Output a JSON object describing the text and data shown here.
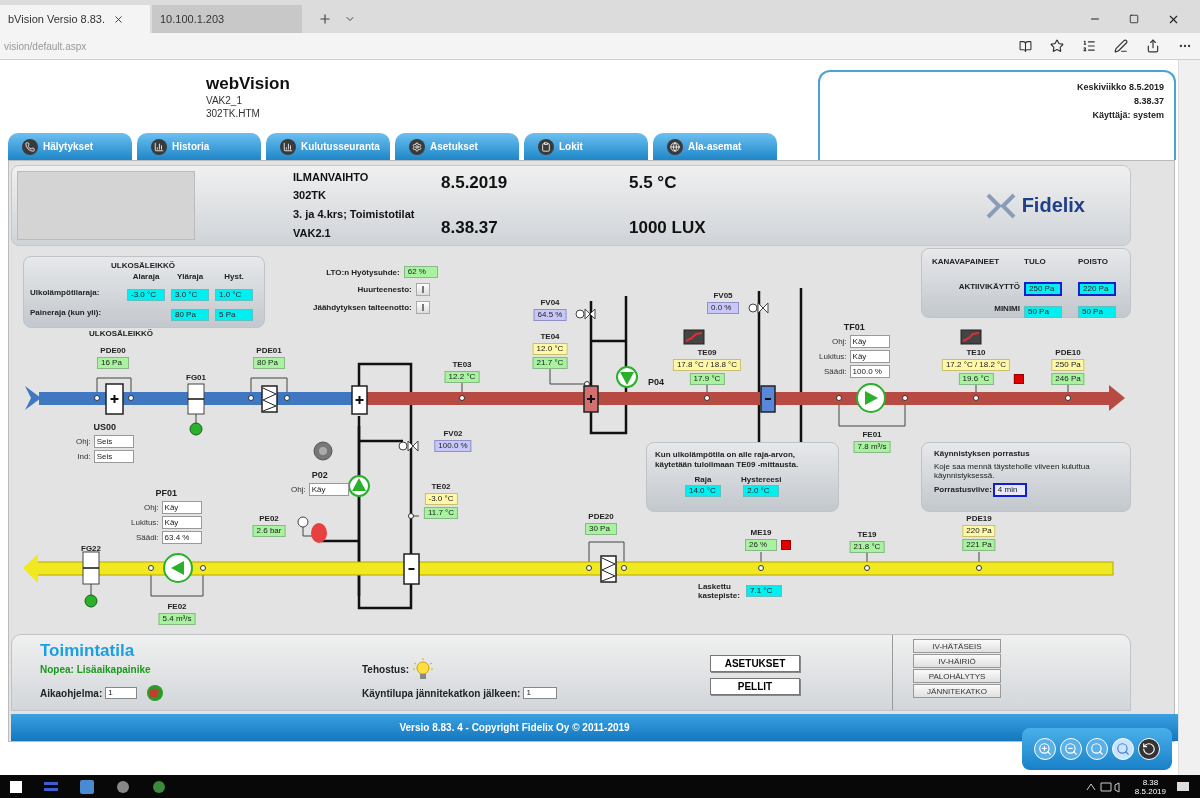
{
  "browser": {
    "tabs": [
      {
        "label": "bVision Versio 8.83.",
        "selected": true
      },
      {
        "label": "10.100.1.203",
        "selected": false
      }
    ],
    "address": "vision/default.aspx"
  },
  "header": {
    "title": "webVision",
    "lines": [
      "VAK2_1",
      "302TK.HTM"
    ],
    "day": "Keskiviikko 8.5.2019",
    "time": "8.38.37",
    "user": "Käyttäjä: system"
  },
  "nav": [
    "Hälytykset",
    "Historia",
    "Kulutusseuranta",
    "Asetukset",
    "Lokit",
    "Ala-asemat"
  ],
  "info": {
    "lines": [
      "ILMANVAIHTO",
      "302TK",
      "3. ja 4.krs; Toimistotilat",
      "VAK2.1"
    ],
    "date": "8.5.2019",
    "time": "8.38.37",
    "temperature": "5.5 °C",
    "lux": "1000 LUX",
    "logo": "Fidelix"
  },
  "outdoor_panel": {
    "title": "ULKOSÄLEIKKÖ",
    "columns": [
      "Alaraja",
      "Yläraja",
      "Hyst."
    ],
    "rows": [
      {
        "label": "Ulkolämpötilaraja:",
        "values": [
          {
            "text": "-3.0 °C",
            "kind": "param"
          },
          {
            "text": "3.0 °C",
            "kind": "param"
          },
          {
            "text": "1.0 °C",
            "kind": "param"
          }
        ]
      },
      {
        "label": "Paineraja (kun yli):",
        "values": [
          {
            "text": "80 Pa",
            "kind": "param"
          },
          {
            "text": "5 Pa",
            "kind": "param"
          }
        ]
      }
    ]
  },
  "lto": {
    "label": "LTO:n Hyötysuhde:",
    "value": "62 %",
    "toggles": [
      "Huurteenesto:",
      "Jäähdytyksen talteenotto:"
    ]
  },
  "duct_pressures": {
    "title": "KANAVAPAINEET",
    "columns": [
      "TULO",
      "POISTO"
    ],
    "rows": [
      {
        "label": "AKTIIVIKÄYTTÖ",
        "values": [
          {
            "text": "250 Pa",
            "kind": "active"
          },
          {
            "text": "220 Pa",
            "kind": "active"
          }
        ]
      },
      {
        "label": "MINIMI",
        "values": [
          {
            "text": "50 Pa",
            "kind": "param"
          },
          {
            "text": "50 Pa",
            "kind": "param"
          }
        ]
      }
    ]
  },
  "labels": [
    "ULKOSÄLEIKKÖ",
    "FG01",
    "P04",
    "FG22"
  ],
  "points": [
    {
      "tag": "PDE00",
      "alarm": false,
      "values": [
        {
          "text": "16 Pa",
          "kind": "measured"
        }
      ]
    },
    {
      "tag": "PDE01",
      "alarm": false,
      "values": [
        {
          "text": "80 Pa",
          "kind": "measured"
        }
      ]
    },
    {
      "tag": "TE03",
      "alarm": false,
      "values": [
        {
          "text": "12.2 °C",
          "kind": "measured"
        }
      ]
    },
    {
      "tag": "FV04",
      "alarm": false,
      "values": [
        {
          "text": "64.5 %",
          "kind": "valve"
        }
      ]
    },
    {
      "tag": "TE04",
      "alarm": false,
      "values": [
        {
          "text": "12.0 °C",
          "kind": "setpoint"
        },
        {
          "text": "21.7 °C",
          "kind": "measured"
        }
      ]
    },
    {
      "tag": "FV05",
      "alarm": false,
      "values": [
        {
          "text": "0.0 %",
          "kind": "valve"
        }
      ]
    },
    {
      "tag": "TE09",
      "alarm": false,
      "values": [
        {
          "text": "17.8 °C / 18.8 °C",
          "kind": "setpoint"
        },
        {
          "text": "17.9 °C",
          "kind": "measured"
        }
      ]
    },
    {
      "tag": "TE10",
      "alarm": true,
      "values": [
        {
          "text": "17.2 °C / 18.2 °C",
          "kind": "setpoint"
        },
        {
          "text": "19.6 °C",
          "kind": "measured"
        }
      ]
    },
    {
      "tag": "PDE10",
      "alarm": false,
      "values": [
        {
          "text": "250 Pa",
          "kind": "setpoint"
        },
        {
          "text": "246 Pa",
          "kind": "measured"
        }
      ]
    },
    {
      "tag": "FV02",
      "alarm": false,
      "values": [
        {
          "text": "100.0 %",
          "kind": "valve"
        }
      ]
    },
    {
      "tag": "FE01",
      "alarm": false,
      "values": [
        {
          "text": "7.8 m³/s",
          "kind": "measured"
        }
      ]
    },
    {
      "tag": "TE02",
      "alarm": false,
      "values": [
        {
          "text": "-3.0 °C",
          "kind": "setpoint"
        },
        {
          "text": "11.7 °C",
          "kind": "measured"
        }
      ]
    },
    {
      "tag": "PE02",
      "alarm": false,
      "values": [
        {
          "text": "2.6 bar",
          "kind": "measured"
        }
      ]
    },
    {
      "tag": "PDE20",
      "alarm": false,
      "values": [
        {
          "text": "30 Pa",
          "kind": "measured"
        }
      ]
    },
    {
      "tag": "ME19",
      "alarm": true,
      "values": [
        {
          "text": "26 %",
          "kind": "measured"
        }
      ]
    },
    {
      "tag": "TE19",
      "alarm": false,
      "values": [
        {
          "text": "21.8 °C",
          "kind": "measured"
        }
      ]
    },
    {
      "tag": "PDE19",
      "alarm": false,
      "values": [
        {
          "text": "220 Pa",
          "kind": "setpoint"
        },
        {
          "text": "221 Pa",
          "kind": "measured"
        }
      ]
    },
    {
      "tag": "FE02",
      "alarm": false,
      "values": [
        {
          "text": "5.4 m³/s",
          "kind": "measured"
        }
      ]
    }
  ],
  "units": [
    {
      "tag": "US00",
      "rows": [
        {
          "label": "Ohj:",
          "value": "Seis"
        },
        {
          "label": "Ind:",
          "value": "Seis"
        }
      ]
    },
    {
      "tag": "TF01",
      "rows": [
        {
          "label": "Ohj:",
          "value": "Käy"
        },
        {
          "label": "Lukitus:",
          "value": "Käy"
        },
        {
          "label": "Säädi:",
          "value": "100.0 %"
        }
      ]
    },
    {
      "tag": "P02",
      "rows": [
        {
          "label": "Ohj:",
          "value": "Käy"
        }
      ]
    },
    {
      "tag": "PF01",
      "rows": [
        {
          "label": "Ohj:",
          "value": "Käy"
        },
        {
          "label": "Lukitus:",
          "value": "Käy"
        },
        {
          "label": "Säädi:",
          "value": "63.4 %"
        }
      ]
    }
  ],
  "dewpoint": {
    "label": "Laskettu kastepiste:",
    "value": "7.1 °C"
  },
  "condition_panel": {
    "text": "Kun ulkolämpötila on alle raja-arvon, käytetään tuloilmaan TE09 -mittausta.",
    "fields": [
      {
        "label": "Raja",
        "value": "14.0 °C"
      },
      {
        "label": "Hystereesi",
        "value": "2.0 °C"
      }
    ]
  },
  "startup_panel": {
    "title": "Käynnistyksen porrastus",
    "text": "Koje saa mennä täysteholle viiveen kuluttua käynnistyksessä.",
    "field_label": "Porrastusviive:",
    "field_value": "4 min"
  },
  "bottom": {
    "title": "Toimintatila",
    "mode": "Nopea: Lisäaikapainike",
    "schedule_label": "Aikaohjelma:",
    "schedule_value": "1",
    "boost_label": "Tehostus:",
    "restart_label": "Käyntilupa jännitekatkon jälkeen:",
    "restart_value": "1",
    "buttons": [
      "ASETUKSET",
      "PELLIT"
    ],
    "alarms": [
      "IV-HÄTÄSEIS",
      "IV-HÄIRIÖ",
      "PALOHÄLYTYS",
      "JÄNNITEKATKO"
    ]
  },
  "footer": "Versio 8.83. 4 - Copyright Fidelix Oy © 2011-2019",
  "taskbar": {
    "time": "8.38",
    "date": "8.5.2019"
  }
}
